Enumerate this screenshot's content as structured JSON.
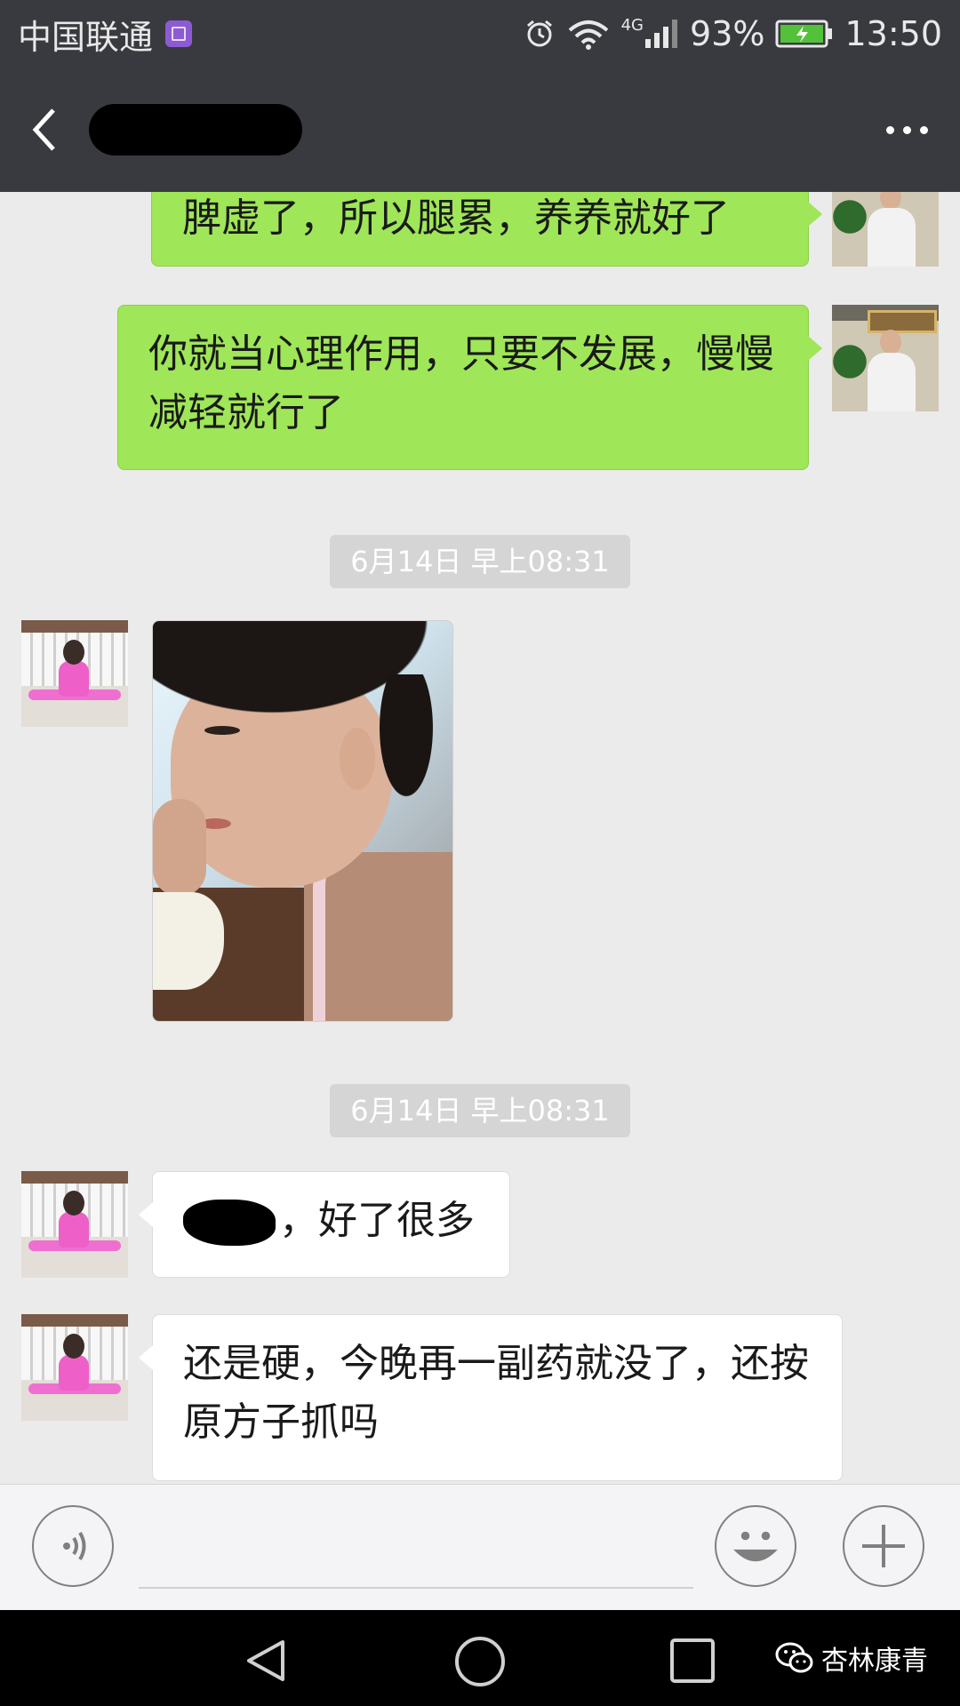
{
  "status_bar": {
    "carrier": "中国联通",
    "network_type": "4G",
    "battery": "93%",
    "time": "13:50",
    "icons": [
      "gallery-notification-icon",
      "alarm-icon",
      "wifi-icon",
      "signal-icon",
      "battery-charging-icon"
    ]
  },
  "title_bar": {
    "back_icon": "chevron-left-icon",
    "contact_name_redacted": true,
    "more_icon": "ellipsis-icon"
  },
  "messages": {
    "m1": {
      "direction": "outgoing",
      "text": "脾虚了，所以腿累，养养就好了"
    },
    "m2": {
      "direction": "outgoing",
      "text": "你就当心理作用，只要不发展，慢慢减轻就行了"
    },
    "ts1": "6月14日 早上08:31",
    "m3": {
      "direction": "incoming",
      "type": "image"
    },
    "ts2": "6月14日 早上08:31",
    "m4": {
      "direction": "incoming",
      "text": "，好了很多"
    },
    "m5": {
      "direction": "incoming",
      "text": "还是硬，今晚再一副药就没了，还按原方子抓吗"
    }
  },
  "input_bar": {
    "voice_icon": "voice-icon",
    "emoji_icon": "emoji-icon",
    "plus_icon": "plus-icon"
  },
  "nav_bar": {
    "icons": [
      "nav-back-icon",
      "nav-home-icon",
      "nav-recents-icon"
    ]
  },
  "watermark": {
    "text": "杏林康青",
    "icon": "wechat-icon"
  },
  "colors": {
    "header": "#393a3f",
    "outgoing_bubble": "#9fe658",
    "incoming_bubble": "#ffffff",
    "chat_background": "#ebebeb",
    "timestamp_bg": "#d5d5d5"
  }
}
